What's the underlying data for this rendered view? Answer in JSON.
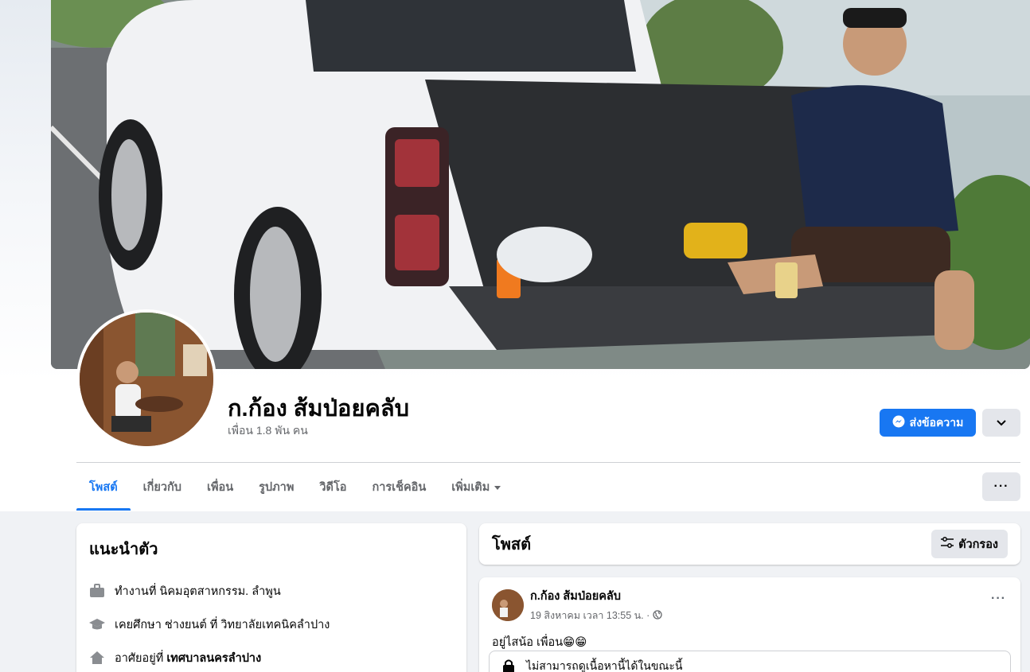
{
  "profile": {
    "name": "ก.ก้อง ส้มป่อยคลับ",
    "friends": "เพื่อน 1.8 พัน คน"
  },
  "actions": {
    "message_label": "ส่งข้อความ"
  },
  "tabs": [
    {
      "label": "โพสต์",
      "active": true
    },
    {
      "label": "เกี่ยวกับ",
      "active": false
    },
    {
      "label": "เพื่อน",
      "active": false
    },
    {
      "label": "รูปภาพ",
      "active": false
    },
    {
      "label": "วิดีโอ",
      "active": false
    },
    {
      "label": "การเช็คอิน",
      "active": false
    },
    {
      "label": "เพิ่มเติม",
      "active": false
    }
  ],
  "intro": {
    "title": "แนะนำตัว",
    "work": "ทำงานที่ นิคมอุตสาหกรรม. ลำพูน",
    "education": "เคยศึกษา ช่างยนต์ ที่ วิทยาลัยเทคนิคลำปาง",
    "home_prefix": "อาศัยอยู่ที่ ",
    "home_place": "เทศบาลนครลำปาง"
  },
  "posts_header": {
    "title": "โพสต์",
    "filter_label": "ตัวกรอง"
  },
  "post": {
    "author": "ก.ก้อง ส้มป่อยคลับ",
    "time": "19 สิงหาคม เวลา 13:55 น. ·",
    "text": "อยู่ไสน้อ เพื่อน😁😁",
    "unavailable": "ไม่สามารถดูเนื้อหานี้ได้ในขณะนี้"
  },
  "colors": {
    "accent": "#1877f2",
    "background": "#f0f2f5",
    "secondary_text": "#65676b"
  }
}
